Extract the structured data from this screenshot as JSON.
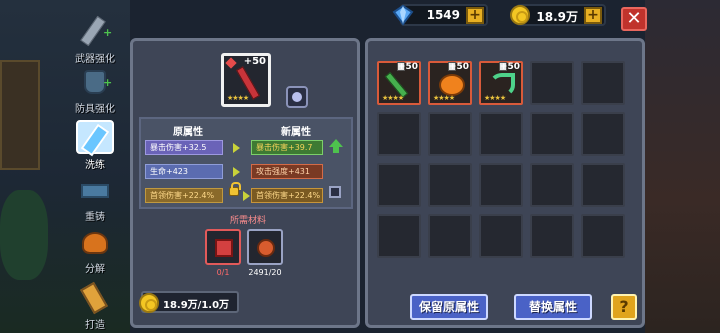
{
  "currency": {
    "gems": "1549",
    "gold": "18.9万",
    "add_symbol": "+"
  },
  "close_symbol": "✕",
  "menu": [
    {
      "label": "武器强化",
      "active": false
    },
    {
      "label": "防具强化",
      "active": false
    },
    {
      "label": "洗练",
      "active": true
    },
    {
      "label": "重铸",
      "active": false
    },
    {
      "label": "分解",
      "active": false
    },
    {
      "label": "打造",
      "active": false
    }
  ],
  "target_item": {
    "level": "+50",
    "stars": "★★★★"
  },
  "attributes": {
    "old_header": "原属性",
    "new_header": "新属性",
    "old": [
      "暴击伤害+32.5",
      "生命+423",
      "首领伤害+22.4%"
    ],
    "new": [
      "暴击伤害+39.7",
      "攻击强度+431",
      "首领伤害+22.4%"
    ]
  },
  "materials": {
    "title": "所需材料",
    "items": [
      {
        "count": "0/1"
      },
      {
        "count": "2491/20"
      }
    ]
  },
  "gold_requirement": "18.9万/1.0万",
  "inventory": [
    {
      "level": "+50",
      "stars": "★★★★",
      "type": "sword"
    },
    {
      "level": "+50",
      "stars": "★★★★",
      "type": "pumpkin"
    },
    {
      "level": "+50",
      "stars": "★★★★",
      "type": "scythe"
    }
  ],
  "buttons": {
    "keep": "保留原属性",
    "replace": "替换属性",
    "help": "?"
  }
}
